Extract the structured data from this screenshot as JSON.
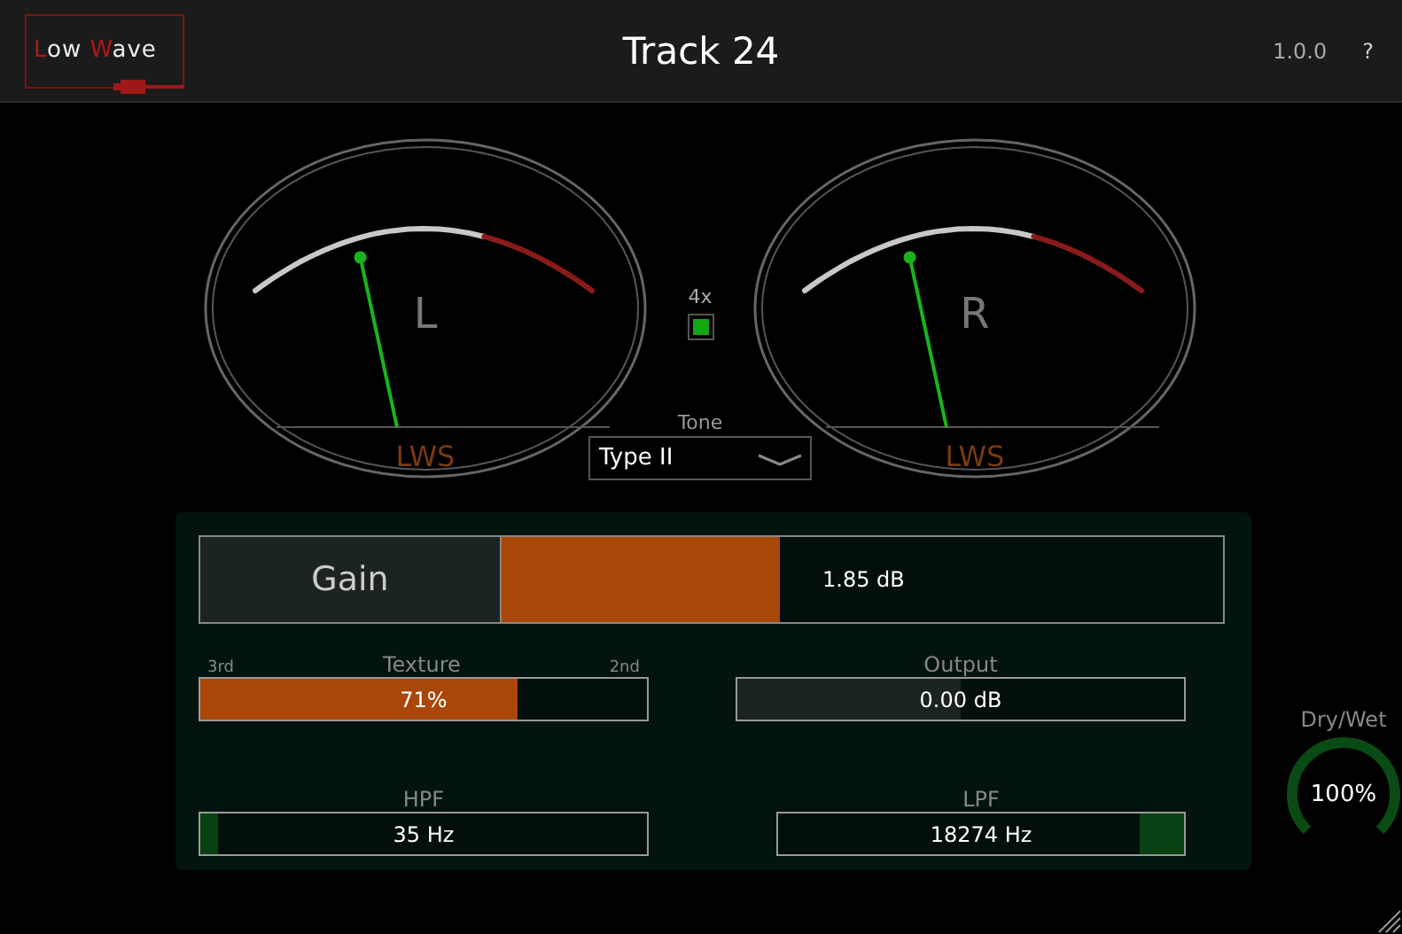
{
  "logo": {
    "parts": [
      {
        "text": "L",
        "accent": true
      },
      {
        "text": "ow ",
        "accent": false
      },
      {
        "text": "W",
        "accent": true
      },
      {
        "text": "ave",
        "accent": false
      }
    ]
  },
  "title": "Track 24",
  "version": "1.0.0",
  "help": "?",
  "meters": [
    {
      "channel": "L",
      "brand": "LWS"
    },
    {
      "channel": "R",
      "brand": "LWS"
    }
  ],
  "oversampling": {
    "label": "4x",
    "on": true
  },
  "tone": {
    "label": "Tone",
    "value": "Type II"
  },
  "gain": {
    "label": "Gain",
    "value": "1.85 dB",
    "level": 0.385
  },
  "texture": {
    "label": "Texture",
    "left": "3rd",
    "right": "2nd",
    "value": "71%",
    "level": 0.71
  },
  "output": {
    "label": "Output",
    "value": "0.00 dB",
    "level": 0.5
  },
  "hpf": {
    "label": "HPF",
    "value": "35 Hz",
    "level": 0.04
  },
  "lpf": {
    "label": "LPF",
    "value": "18274 Hz",
    "level": 0.11
  },
  "drywet": {
    "label": "Dry/Wet",
    "value": "100%"
  }
}
